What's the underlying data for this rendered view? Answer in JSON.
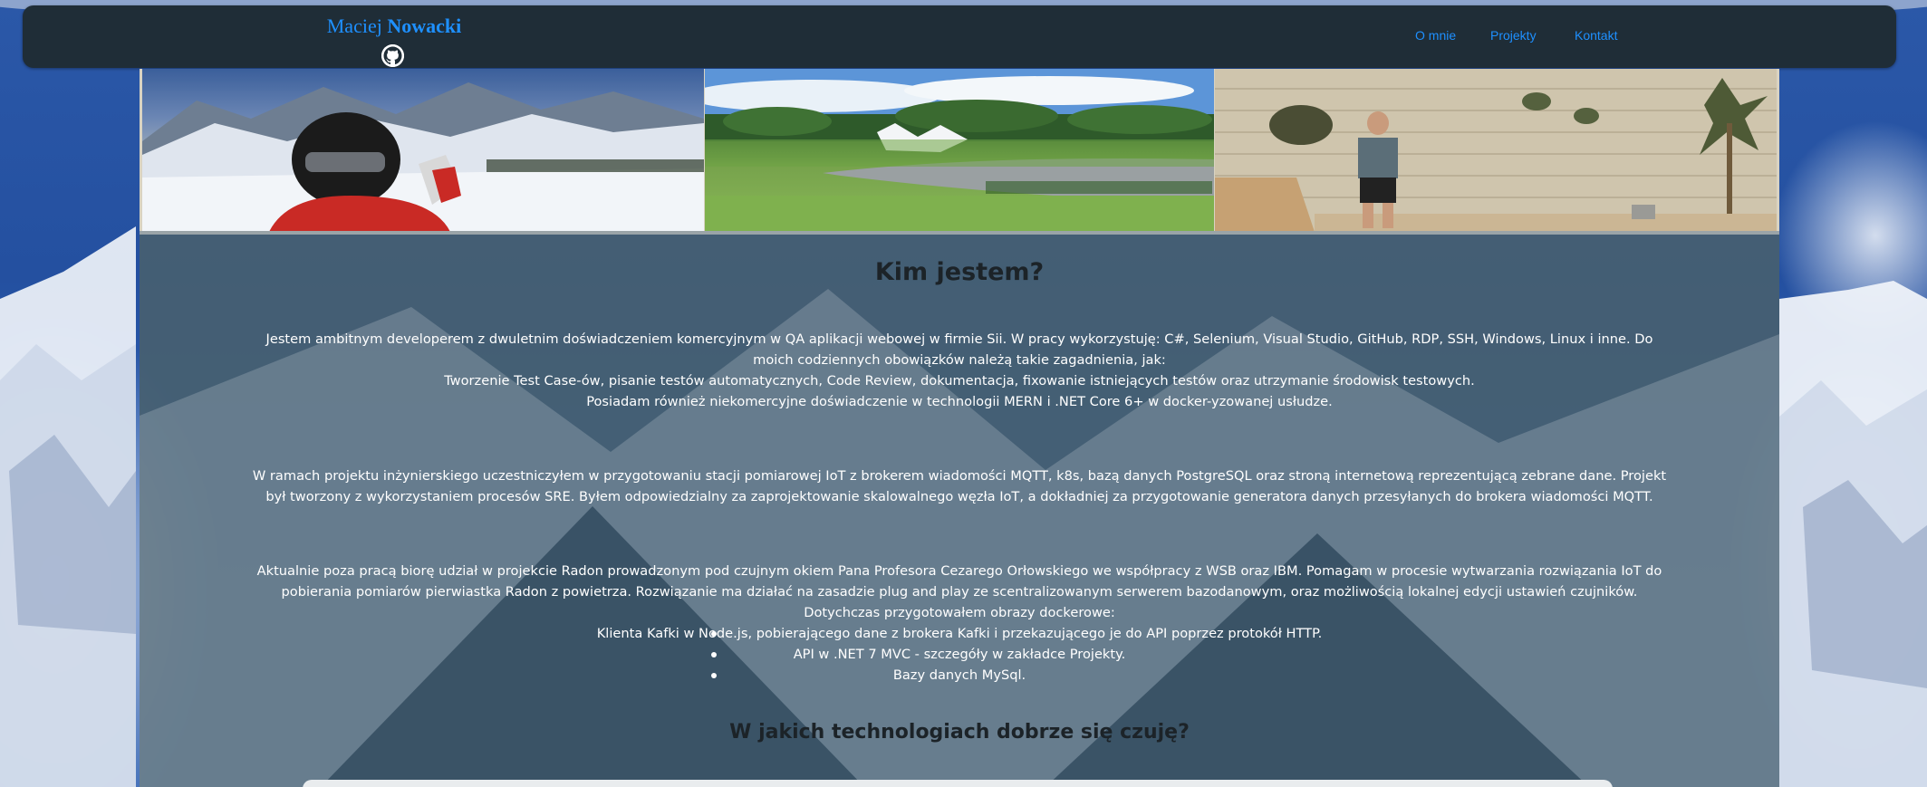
{
  "navbar": {
    "brand_first": "Maciej",
    "brand_last": "Nowacki",
    "github_icon": "github-icon",
    "links": [
      "O mnie",
      "Projekty",
      "Kontakt"
    ],
    "link_color": "#1e90ff",
    "background": "#1f2d37"
  },
  "hero": {
    "photos": [
      "skiing-photo",
      "park-fountain-photo",
      "stone-wall-portrait-photo"
    ]
  },
  "about": {
    "heading": "Kim jestem?",
    "paragraph1_lines": [
      "Jestem ambitnym developerem z dwuletnim doświadczeniem komercyjnym w QA aplikacji webowej w firmie Sii. W pracy wykorzystuję: C#, Selenium, Visual Studio, GitHub, RDP, SSH, Windows, Linux i inne. Do moich codziennych obowiązków należą takie zagadnienia, jak:",
      "Tworzenie Test Case-ów, pisanie testów automatycznych, Code Review, dokumentacja, fixowanie istniejących testów oraz utrzymanie środowisk testowych.",
      "Posiadam również niekomercyjne doświadczenie w technologii MERN i .NET Core 6+ w docker-yzowanej usłudze."
    ],
    "paragraph2": "W ramach projektu inżynierskiego uczestniczyłem w przygotowaniu stacji pomiarowej IoT z brokerem wiadomości MQTT, k8s, bazą danych PostgreSQL oraz stroną internetową reprezentującą zebrane dane. Projekt był tworzony z wykorzystaniem procesów SRE. Byłem odpowiedzialny za zaprojektowanie skalowalnego węzła IoT, a dokładniej za przygotowanie generatora danych przesyłanych do brokera wiadomości MQTT.",
    "paragraph3": "Aktualnie poza pracą biorę udział w projekcie Radon prowadzonym pod czujnym okiem Pana Profesora Cezarego Orłowskiego we współpracy z WSB oraz IBM. Pomagam w procesie wytwarzania rozwiązania IoT do pobierania pomiarów pierwiastka Radon z powietrza. Rozwiązanie ma działać na zasadzie plug and play ze scentralizowanym serwerem bazodanowym, oraz możliwością lokalnej edycji ustawień czujników. Dotychczas przygotowałem obrazy dockerowe:",
    "docker_images": [
      "Klienta Kafki w Node.js, pobierającego dane z brokera Kafki i przekazującego je do API poprzez protokół HTTP.",
      "API w .NET 7 MVC - szczegóły w zakładce Projekty.",
      "Bazy danych MySql."
    ]
  },
  "tech": {
    "heading": "W jakich technologiach dobrze się czuję?"
  }
}
